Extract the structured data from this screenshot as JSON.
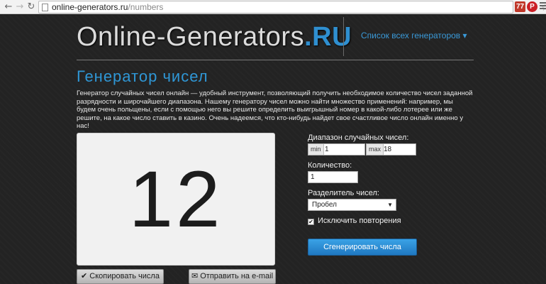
{
  "browser": {
    "url_host": "online-generators.ru",
    "url_path": "/numbers",
    "extension1_label": "77"
  },
  "header": {
    "logo_main": "Online-Generators",
    "logo_tld": ".RU",
    "generators_menu": "Список всех генераторов ▾"
  },
  "main": {
    "title": "Генератор чисел",
    "intro": "Генератор случайных чисел онлайн — удобный инструмент, позволяющий получить необходимое количество чисел заданной разрядности и широчайшего диапазона. Нашему генератору чисел можно найти множество применений: например, мы будем очень польщены, если с помощью него вы решите определить выигрышный номер в какой-либо лотерее или же решите, на какое число ставить в казино. Очень надеемся, что кто-нибудь найдет свое счастливое число онлайн именно у нас!"
  },
  "result": {
    "value": "12",
    "copy_button": "✔ Скопировать числа",
    "email_button": "✉ Отправить на e-mail"
  },
  "form": {
    "range_label": "Диапазон случайных чисел:",
    "min_addon": "min",
    "min_value": "1",
    "max_addon": "max",
    "max_value": "18",
    "count_label": "Количество:",
    "count_value": "1",
    "separator_label": "Разделитель чисел:",
    "separator_value": "Пробел",
    "exclude_repeats_label": "Исключить повторения",
    "exclude_repeats_checked": true,
    "generate_button": "Сгенерировать числа"
  },
  "colors": {
    "accent": "#2f97d6",
    "background": "#232323",
    "button_blue": "#1f78c1"
  }
}
